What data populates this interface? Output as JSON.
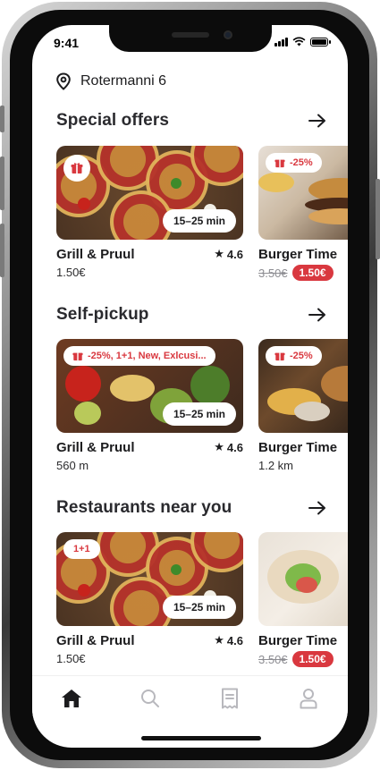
{
  "status": {
    "time": "9:41"
  },
  "location": {
    "address": "Rotermanni 6",
    "icon": "location-pin-icon"
  },
  "sections": [
    {
      "title": "Special offers",
      "cards": [
        {
          "name": "Grill & Pruul",
          "subtitle": "1.50€",
          "rating": "4.6",
          "badge_icon": "gift-icon",
          "time": "15–25 min"
        },
        {
          "name": "Burger Time",
          "badge_text": "-25%",
          "old_price": "3.50€",
          "new_price": "1.50€"
        }
      ]
    },
    {
      "title": "Self-pickup",
      "cards": [
        {
          "name": "Grill & Pruul",
          "subtitle": "560 m",
          "rating": "4.6",
          "badge_text": "-25%, 1+1, New, Exlcusi...",
          "time": "15–25 min"
        },
        {
          "name": "Burger Time",
          "subtitle": "1.2 km",
          "badge_text": "-25%"
        }
      ]
    },
    {
      "title": "Restaurants near you",
      "cards": [
        {
          "name": "Grill & Pruul",
          "subtitle": "1.50€",
          "rating": "4.6",
          "badge_text": "1+1",
          "time": "15–25 min"
        },
        {
          "name": "Burger Time",
          "old_price": "3.50€",
          "new_price": "1.50€"
        }
      ]
    }
  ],
  "tabbar": {
    "items": [
      "home-icon",
      "search-icon",
      "receipt-icon",
      "profile-icon"
    ],
    "active": "home-icon"
  },
  "colors": {
    "accent": "#d9383f",
    "text": "#1c1c1e",
    "muted": "#8e8e93",
    "tab_inactive": "#b8b8bd"
  }
}
